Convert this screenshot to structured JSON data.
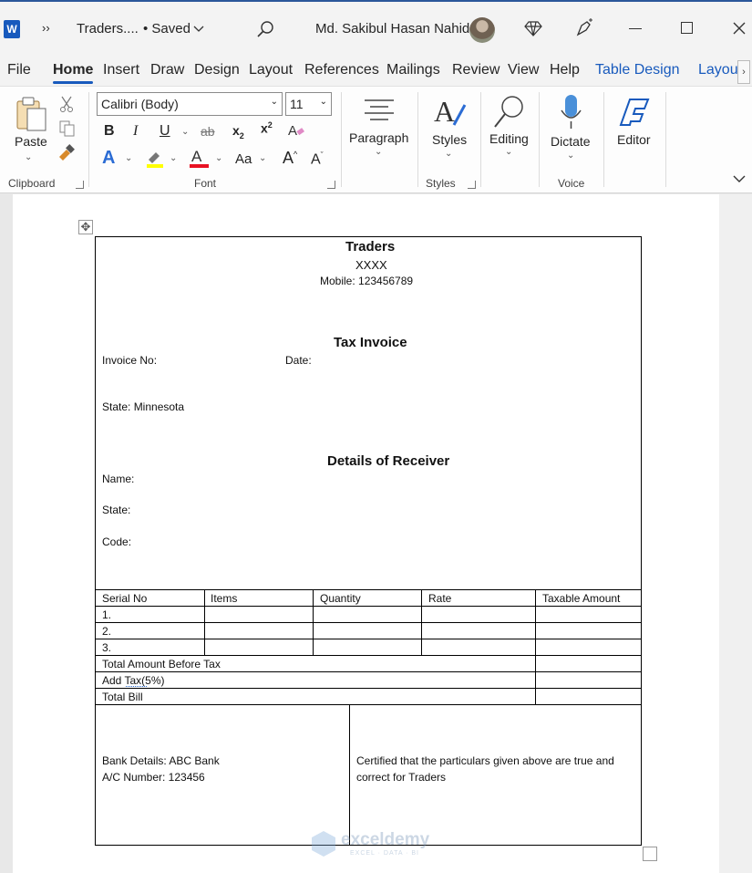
{
  "titlebar": {
    "overflow": "››",
    "doc_name": "Traders....",
    "saved": "• Saved",
    "user_name": "Md. Sakibul Hasan Nahid"
  },
  "tabs": [
    "File",
    "Home",
    "Insert",
    "Draw",
    "Design",
    "Layout",
    "References",
    "Mailings",
    "Review",
    "View",
    "Help",
    "Table Design",
    "Layou"
  ],
  "ribbon": {
    "paste": "Paste",
    "clipboard": "Clipboard",
    "font_name": "Calibri (Body)",
    "font_size": "11",
    "font_group": "Font",
    "change_case": "Aa",
    "paragraph": "Paragraph",
    "styles": "Styles",
    "styles_group": "Styles",
    "editing": "Editing",
    "dictate": "Dictate",
    "voice_group": "Voice",
    "editor": "Editor"
  },
  "colors": {
    "accent": "#185abd",
    "highlight": "#ffff00",
    "font_color": "#e81123"
  },
  "document": {
    "company": "Traders",
    "address": "XXXX",
    "mobile": "Mobile: 123456789",
    "tax_invoice": "Tax Invoice",
    "invoice_no": "Invoice No:",
    "date": "Date:",
    "state_line": "State: Minnesota",
    "receiver_heading": "Details of Receiver",
    "name": "Name:",
    "state": "State:",
    "code": "Code:",
    "columns": [
      "Serial No",
      "Items",
      "Quantity",
      "Rate",
      "Taxable Amount"
    ],
    "rows": [
      "1.",
      "2.",
      "3."
    ],
    "total_before_tax": "Total Amount Before Tax",
    "add_tax": "Add Tax(5%)",
    "total_bill": "Total Bill",
    "bank_details": "Bank Details: ABC Bank",
    "ac_number": "A/C Number: 123456",
    "cert_line1": "Certified that the particulars given above are true and",
    "cert_line2": "correct for Traders"
  },
  "watermark": {
    "brand": "exceldemy",
    "tagline": "EXCEL · DATA · BI"
  }
}
